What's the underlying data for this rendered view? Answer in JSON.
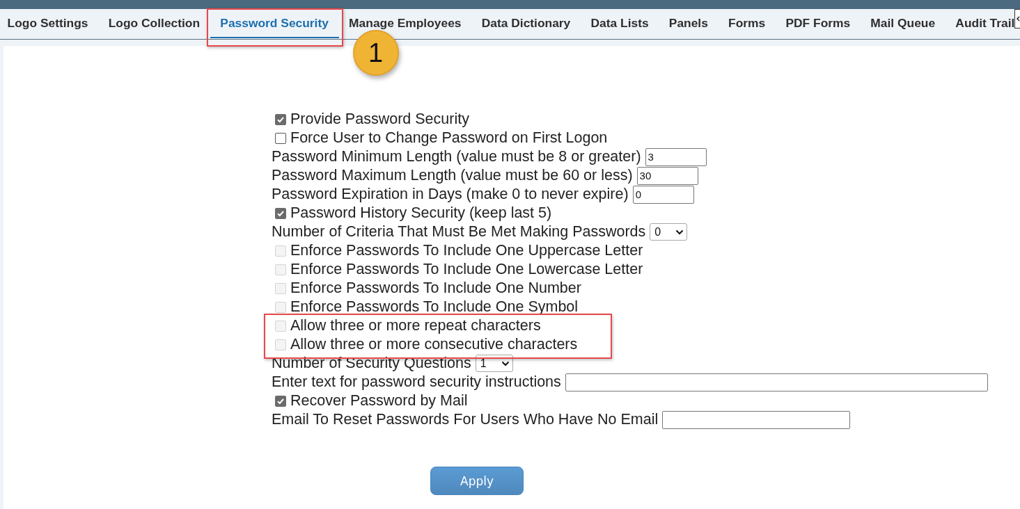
{
  "tabs": [
    {
      "label": "Logo Settings",
      "selected": false,
      "highlighted": false
    },
    {
      "label": "Logo Collection",
      "selected": false,
      "highlighted": false
    },
    {
      "label": "Password Security",
      "selected": true,
      "highlighted": true,
      "callout": "1"
    },
    {
      "label": "Manage Employees",
      "selected": false,
      "highlighted": false
    },
    {
      "label": "Data Dictionary",
      "selected": false,
      "highlighted": false
    },
    {
      "label": "Data Lists",
      "selected": false,
      "highlighted": false
    },
    {
      "label": "Panels",
      "selected": false,
      "highlighted": false
    },
    {
      "label": "Forms",
      "selected": false,
      "highlighted": false
    },
    {
      "label": "PDF Forms",
      "selected": false,
      "highlighted": false
    },
    {
      "label": "Mail Queue",
      "selected": false,
      "highlighted": false
    },
    {
      "label": "Audit Trail",
      "selected": false,
      "highlighted": false
    }
  ],
  "form": {
    "rows": [
      {
        "kind": "checkbox",
        "label": "Provide Password Security",
        "checked": true,
        "disabled": false,
        "highlighted": false
      },
      {
        "kind": "checkbox",
        "label": "Force User to Change Password on First Logon",
        "checked": false,
        "disabled": false,
        "highlighted": false
      },
      {
        "kind": "number",
        "label": "Password Minimum Length (value must be 8 or greater)",
        "value": "3",
        "highlighted": false
      },
      {
        "kind": "number",
        "label": "Password Maximum Length (value must be 60 or less)",
        "value": "30",
        "highlighted": false
      },
      {
        "kind": "number",
        "label": "Password Expiration in Days (make 0 to never expire)",
        "value": "0",
        "highlighted": false
      },
      {
        "kind": "checkbox",
        "label": "Password History Security (keep last 5)",
        "checked": true,
        "disabled": false,
        "highlighted": false
      },
      {
        "kind": "select",
        "label": "Number of Criteria That Must Be Met Making Passwords",
        "value": "0",
        "highlighted": false
      },
      {
        "kind": "checkbox",
        "label": "Enforce Passwords To Include One Uppercase Letter",
        "checked": false,
        "disabled": true,
        "highlighted": false
      },
      {
        "kind": "checkbox",
        "label": "Enforce Passwords To Include One Lowercase Letter",
        "checked": false,
        "disabled": true,
        "highlighted": false
      },
      {
        "kind": "checkbox",
        "label": "Enforce Passwords To Include One Number",
        "checked": false,
        "disabled": true,
        "highlighted": false
      },
      {
        "kind": "checkbox",
        "label": "Enforce Passwords To Include One Symbol",
        "checked": false,
        "disabled": true,
        "highlighted": false
      },
      {
        "kind": "checkbox",
        "label": "Allow three or more repeat characters",
        "checked": false,
        "disabled": true,
        "highlighted": true
      },
      {
        "kind": "checkbox",
        "label": "Allow three or more consecutive characters",
        "checked": false,
        "disabled": true,
        "highlighted": true
      },
      {
        "kind": "select",
        "label": "Number of Security Questions",
        "value": "1",
        "highlighted": false
      },
      {
        "kind": "text",
        "label": "Enter text for password security instructions",
        "value": "",
        "highlighted": false
      },
      {
        "kind": "checkbox",
        "label": "Recover Password by Mail",
        "checked": true,
        "disabled": false,
        "highlighted": false
      },
      {
        "kind": "email",
        "label": "Email To Reset Passwords For Users Who Have No Email",
        "value": "",
        "highlighted": false
      }
    ],
    "apply_button": "Apply"
  }
}
